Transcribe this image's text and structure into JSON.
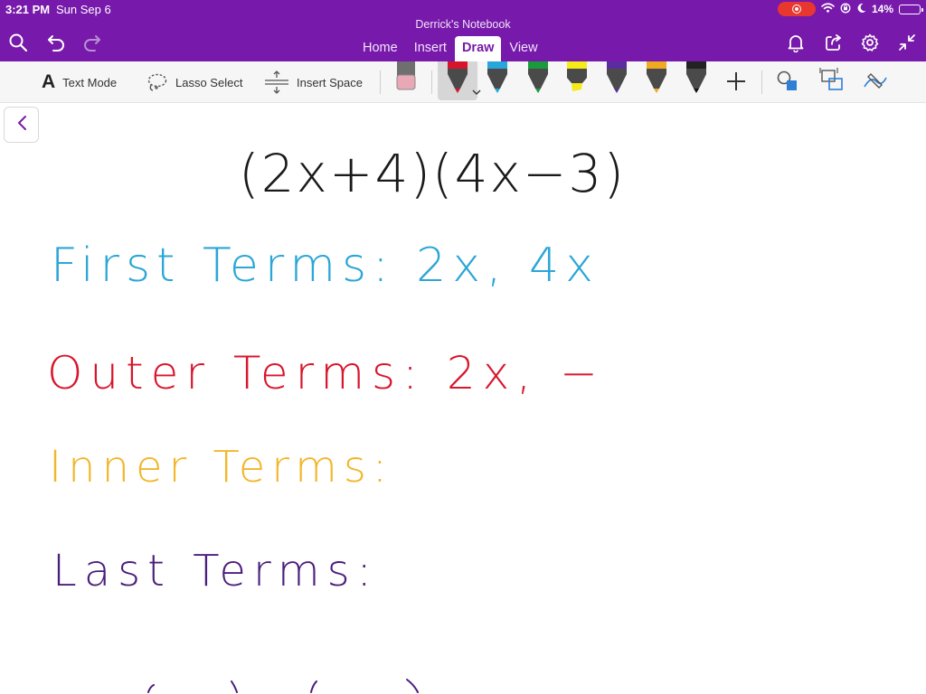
{
  "status": {
    "time": "3:21 PM",
    "date": "Sun Sep 6",
    "battery": "14%",
    "battery_level": 0.14,
    "icons": [
      "screen-record-icon",
      "wifi-icon",
      "orientation-lock-icon",
      "moon-icon",
      "battery-icon"
    ]
  },
  "app": {
    "notebook_title": "Derrick's Notebook",
    "accent_color": "#7719aa"
  },
  "tabs": [
    {
      "label": "Home",
      "active": false
    },
    {
      "label": "Insert",
      "active": false
    },
    {
      "label": "Draw",
      "active": true
    },
    {
      "label": "View",
      "active": false
    }
  ],
  "toolbar": {
    "text_mode_label": "Text Mode",
    "lasso_select_label": "Lasso Select",
    "insert_space_label": "Insert Space",
    "pens": [
      {
        "name": "eraser",
        "color": "#e9a8b6"
      },
      {
        "name": "red-pen",
        "color": "#d6152c",
        "selected": true
      },
      {
        "name": "blue-pen",
        "color": "#27a6d9"
      },
      {
        "name": "green-pen",
        "color": "#199a3c"
      },
      {
        "name": "yellow-highlighter",
        "color": "#f5ea1a"
      },
      {
        "name": "purple-pen",
        "color": "#5a2ca0"
      },
      {
        "name": "orange-pen",
        "color": "#f0a923"
      },
      {
        "name": "black-pen",
        "color": "#222222"
      }
    ]
  },
  "notes": {
    "expression": "(2x+4)(4x−3)",
    "first_terms": "First Terms: 2x, 4x",
    "outer_terms": "Outer Terms: 2x, −",
    "inner_terms": "Inner Terms:",
    "last_terms": "Last Terms:",
    "colors": {
      "expression": "#1a1a1a",
      "first": "#2ba6d6",
      "outer": "#d8162c",
      "inner": "#f2b62a",
      "last": "#4b1e7c"
    }
  }
}
